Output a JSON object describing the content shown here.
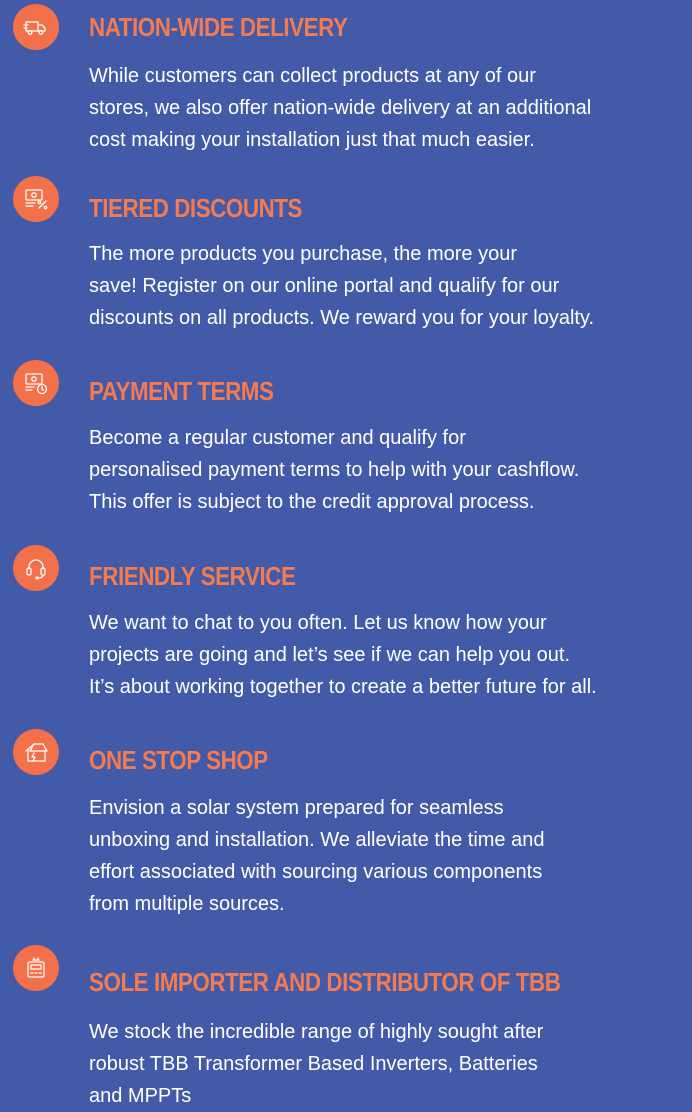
{
  "colors": {
    "background": "#435aa9",
    "accent": "#f2704a",
    "title": "#f47b50",
    "text": "#ffffff"
  },
  "features": [
    {
      "icon": "delivery-truck-icon",
      "title": "NATION-WIDE DELIVERY",
      "lines": [
        "While customers can collect products at any of our",
        "stores, we also offer nation-wide delivery at an additional",
        "cost making your installation just that much easier."
      ]
    },
    {
      "icon": "discount-money-icon",
      "title": "TIERED DISCOUNTS",
      "lines": [
        "The more products you purchase, the more your",
        "save! Register on  our online portal and qualify for our",
        "discounts on all products. We reward you for your loyalty."
      ]
    },
    {
      "icon": "payment-clock-icon",
      "title": "PAYMENT TERMS",
      "lines": [
        "Become a regular customer and qualify for",
        "personalised payment terms to help with your cashflow.",
        "This offer is subject to the credit approval process."
      ]
    },
    {
      "icon": "headset-icon",
      "title": "FRIENDLY SERVICE",
      "lines": [
        "We want to chat to you often. Let us know how your",
        "projects are going and let’s see if we can help you out.",
        "It’s about working together to create a better future for all."
      ]
    },
    {
      "icon": "solar-house-icon",
      "title": "ONE STOP SHOP",
      "lines": [
        "Envision a solar system prepared for seamless",
        "unboxing and installation. We alleviate the time and",
        "effort associated with sourcing various components",
        "from multiple sources."
      ]
    },
    {
      "icon": "inverter-icon",
      "title": "SOLE IMPORTER AND DISTRIBUTOR OF TBB",
      "lines": [
        "We stock the incredible range of highly sought after",
        "robust TBB Transformer Based Inverters, Batteries",
        "and MPPTs"
      ]
    }
  ]
}
